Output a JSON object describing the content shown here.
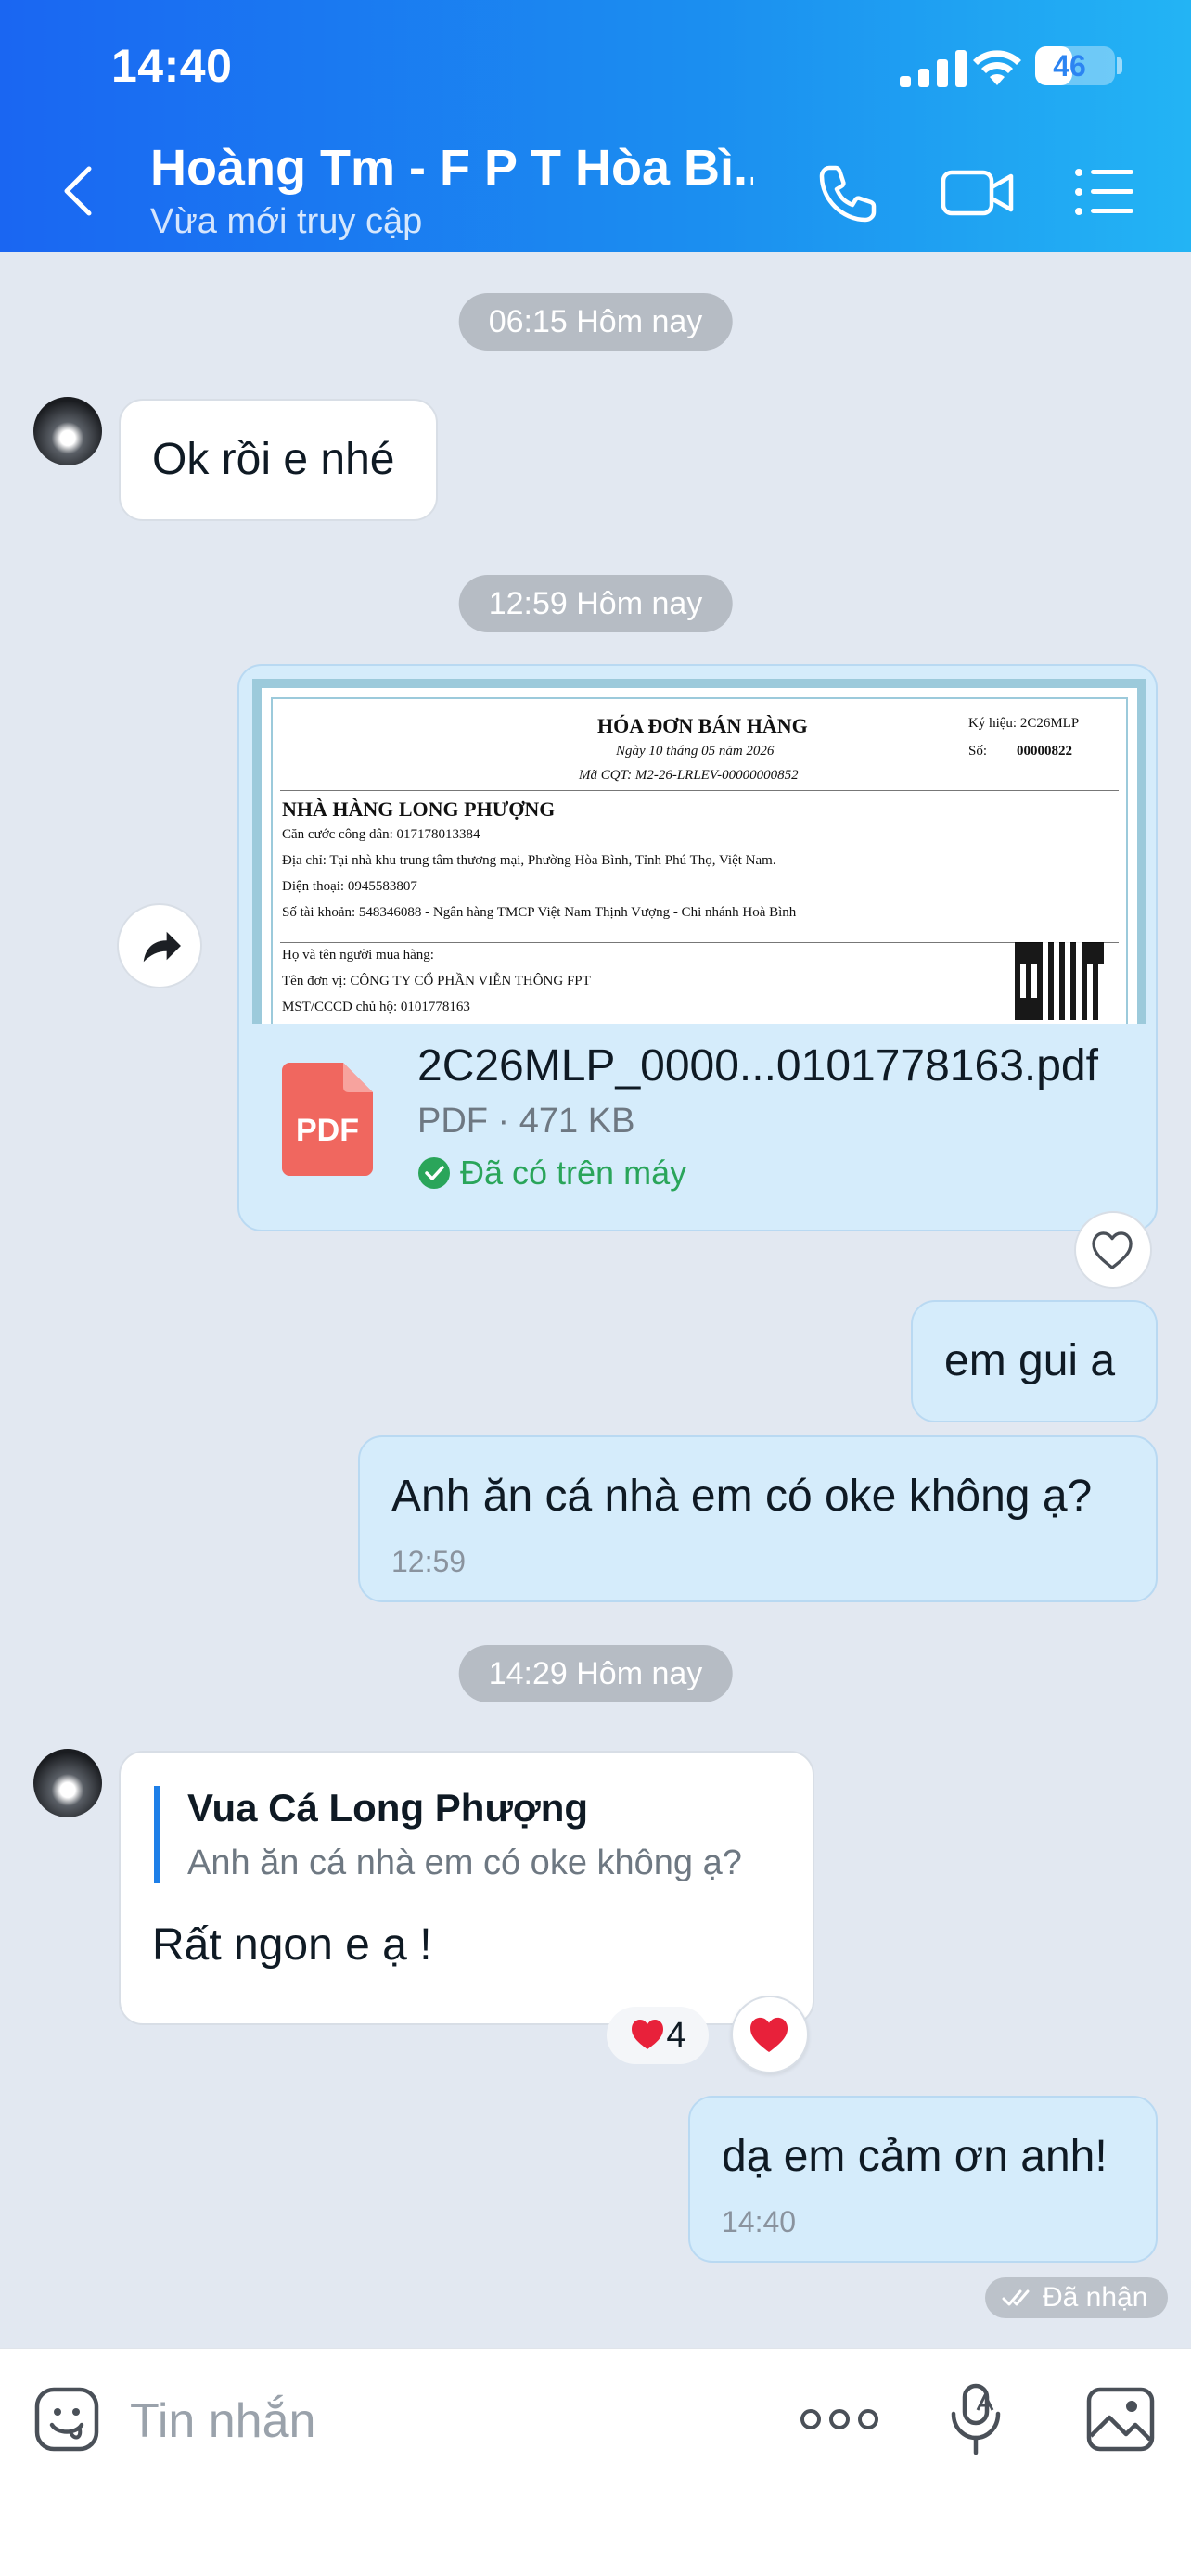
{
  "status_bar": {
    "time": "14:40",
    "battery": "46",
    "battery_level": 0.46
  },
  "header": {
    "contact_name": "Hoàng Tm - F P T Hòa Bì...",
    "contact_status": "Vừa mới truy cập"
  },
  "messages": {
    "pill_1": "06:15 Hôm nay",
    "msg_ok": "Ok rồi e nhé",
    "pill_2": "12:59 Hôm nay",
    "file": {
      "name": "2C26MLP_0000...0101778163.pdf",
      "meta": "PDF · 471 KB",
      "status": "Đã có trên máy",
      "icon_label": "PDF",
      "preview": {
        "title": "HÓA ĐƠN BÁN HÀNG",
        "date": "Ngày 10 tháng 05 năm 2026",
        "code": "Mã CQT: M2-26-LRLEV-00000000852",
        "sign_label": "Ký hiệu: 2C26MLP",
        "num_label": "Số:",
        "num": "00000822",
        "shop": "NHÀ HÀNG LONG PHƯỢNG",
        "id_line": "Căn cước công dân: 017178013384",
        "address": "Địa chỉ: Tại nhà khu trung tâm thương mại, Phường Hòa Bình, Tỉnh Phú Thọ, Việt Nam.",
        "phone": "Điện thoại: 0945583807",
        "account": "Số tài khoản: 548346088 - Ngân hàng TMCP Việt Nam Thịnh Vượng - Chi nhánh Hoà Bình",
        "buyer": "Họ và tên người mua hàng:",
        "unit": "Tên đơn vị: CÔNG TY CỔ PHẦN VIỄN THÔNG FPT",
        "tax": "MST/CCCD chủ hộ: 0101778163"
      }
    },
    "msg_em_gui": "em gui a",
    "msg_anh_an": "Anh ăn cá nhà em có oke không ạ?",
    "msg_anh_an_time": "12:59",
    "pill_3": "14:29 Hôm nay",
    "reply": {
      "quote_name": "Vua Cá Long Phượng",
      "quote_text": "Anh ăn cá nhà em có oke không ạ?",
      "text": "Rất ngon e ạ !",
      "reaction_count": "4"
    },
    "msg_cam_on": "dạ em cảm ơn anh!",
    "msg_cam_on_time": "14:40",
    "received": "Đã nhận"
  },
  "composer": {
    "placeholder": "Tin nhắn"
  },
  "colors": {
    "accent": "#1e7fe8",
    "outgoing_bubble": "#d5ecfb",
    "background": "#e2e8f1",
    "pdf_icon": "#f0675f",
    "success": "#2aa55a",
    "reaction": "#e8213a"
  },
  "icons": [
    "back-icon",
    "phone-icon",
    "video-icon",
    "menu-icon",
    "share-icon",
    "heart-icon",
    "emoji-icon",
    "more-icon",
    "mic-icon",
    "image-icon"
  ]
}
